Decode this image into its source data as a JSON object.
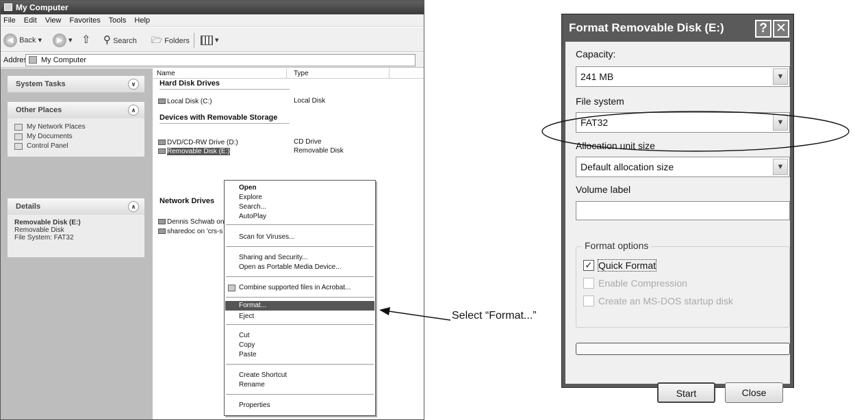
{
  "explorer": {
    "title": "My Computer",
    "menu": [
      "File",
      "Edit",
      "View",
      "Favorites",
      "Tools",
      "Help"
    ],
    "toolbar": {
      "back": "Back",
      "search": "Search",
      "folders": "Folders"
    },
    "address_label": "Address",
    "address_value": "My Computer",
    "task_panels": {
      "system_tasks": "System Tasks",
      "other_places": "Other Places",
      "other_places_items": [
        "My Network Places",
        "My Documents",
        "Control Panel"
      ],
      "details": "Details",
      "details_title": "Removable Disk (E:)",
      "details_lines": [
        "Removable Disk",
        "File System: FAT32"
      ]
    },
    "columns": {
      "name": "Name",
      "type": "Type"
    },
    "groups": {
      "hard_disk": "Hard Disk Drives",
      "removable": "Devices with Removable Storage",
      "network": "Network Drives"
    },
    "drives": {
      "local": {
        "name": "Local Disk (C:)",
        "type": "Local Disk"
      },
      "dvd": {
        "name": "DVD/CD-RW Drive (D:)",
        "type": "CD Drive"
      },
      "removable": {
        "name": "Removable Disk (E:)",
        "type": "Removable Disk"
      },
      "net1": {
        "name": "Dennis Schwab on"
      },
      "net2": {
        "name": "sharedoc on 'crs-s"
      }
    },
    "context_menu": {
      "open": "Open",
      "explore": "Explore",
      "search": "Search...",
      "autoplay": "AutoPlay",
      "scan": "Scan for Viruses...",
      "sharing": "Sharing and Security...",
      "portable": "Open as Portable Media Device...",
      "combine": "Combine supported files in Acrobat...",
      "format": "Format...",
      "eject": "Eject",
      "cut": "Cut",
      "copy": "Copy",
      "paste": "Paste",
      "shortcut": "Create Shortcut",
      "rename": "Rename",
      "properties": "Properties"
    }
  },
  "annotation": "Select “Format...”",
  "dialog": {
    "title": "Format Removable Disk (E:)",
    "help_glyph": "?",
    "close_glyph": "✕",
    "capacity_label": "Capacity:",
    "capacity_value": "241 MB",
    "filesystem_label": "File system",
    "filesystem_value": "FAT32",
    "alloc_label": "Allocation unit size",
    "alloc_value": "Default allocation size",
    "volume_label": "Volume label",
    "volume_value": "",
    "options_legend": "Format options",
    "quick_format": "Quick Format",
    "quick_format_checked": true,
    "compression": "Enable Compression",
    "msdos": "Create an MS-DOS startup disk",
    "progress": 0,
    "start": "Start",
    "close": "Close"
  }
}
